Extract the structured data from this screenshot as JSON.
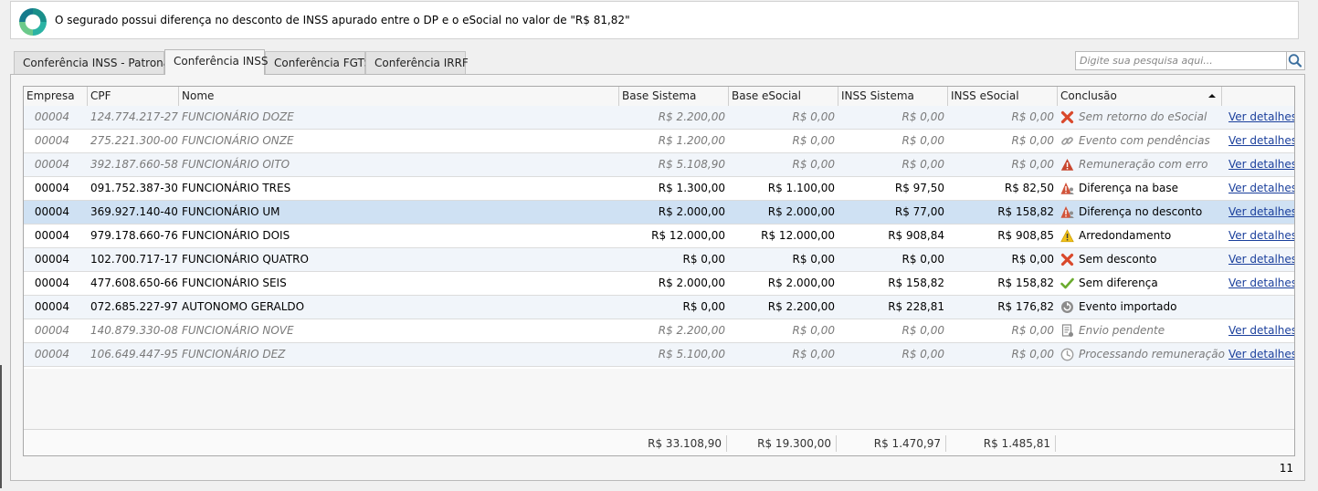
{
  "banner": {
    "message": "O segurado possui diferença no desconto de INSS apurado entre o DP e o eSocial no valor de \"R$ 81,82\""
  },
  "tabs": [
    {
      "label": "Conferência INSS - Patronal",
      "active": false
    },
    {
      "label": "Conferência INSS",
      "active": true
    },
    {
      "label": "Conferência FGTS",
      "active": false
    },
    {
      "label": "Conferência IRRF",
      "active": false
    }
  ],
  "search": {
    "placeholder": "Digite sua pesquisa aqui..."
  },
  "columns": [
    "Empresa",
    "CPF",
    "Nome",
    "Base Sistema",
    "Base eSocial",
    "INSS Sistema",
    "INSS eSocial",
    "Conclusão"
  ],
  "link_label": "Ver detalhes",
  "rows": [
    {
      "empresa": "00004",
      "cpf": "124.774.217-27",
      "nome": "FUNCIONÁRIO DOZE",
      "base_sistema": "R$ 2.200,00",
      "base_esocial": "R$ 0,00",
      "inss_sistema": "R$ 0,00",
      "inss_esocial": "R$ 0,00",
      "conclusao": "Sem retorno do eSocial",
      "icon": "red-x-icon",
      "link": true,
      "style": "dim"
    },
    {
      "empresa": "00004",
      "cpf": "275.221.300-00",
      "nome": "FUNCIONÁRIO ONZE",
      "base_sistema": "R$ 1.200,00",
      "base_esocial": "R$ 0,00",
      "inss_sistema": "R$ 0,00",
      "inss_esocial": "R$ 0,00",
      "conclusao": "Evento com pendências",
      "icon": "chain-link-icon",
      "link": true,
      "style": "dim"
    },
    {
      "empresa": "00004",
      "cpf": "392.187.660-58",
      "nome": "FUNCIONÁRIO OITO",
      "base_sistema": "R$ 5.108,90",
      "base_esocial": "R$ 0,00",
      "inss_sistema": "R$ 0,00",
      "inss_esocial": "R$ 0,00",
      "conclusao": "Remuneração com erro",
      "icon": "red-warning-icon",
      "link": true,
      "style": "dim"
    },
    {
      "empresa": "00004",
      "cpf": "091.752.387-30",
      "nome": "FUNCIONÁRIO TRES",
      "base_sistema": "R$ 1.300,00",
      "base_esocial": "R$ 1.100,00",
      "inss_sistema": "R$ 97,50",
      "inss_esocial": "R$ 82,50",
      "conclusao": "Diferença na base",
      "icon": "warning-person-icon",
      "link": true,
      "style": "normal"
    },
    {
      "empresa": "00004",
      "cpf": "369.927.140-40",
      "nome": "FUNCIONÁRIO UM",
      "base_sistema": "R$ 2.000,00",
      "base_esocial": "R$ 2.000,00",
      "inss_sistema": "R$ 77,00",
      "inss_esocial": "R$ 158,82",
      "conclusao": "Diferença no desconto",
      "icon": "warning-person-icon",
      "link": true,
      "style": "selected"
    },
    {
      "empresa": "00004",
      "cpf": "979.178.660-76",
      "nome": "FUNCIONÁRIO DOIS",
      "base_sistema": "R$ 12.000,00",
      "base_esocial": "R$ 12.000,00",
      "inss_sistema": "R$ 908,84",
      "inss_esocial": "R$ 908,85",
      "conclusao": "Arredondamento",
      "icon": "yellow-warning-icon",
      "link": true,
      "style": "normal"
    },
    {
      "empresa": "00004",
      "cpf": "102.700.717-17",
      "nome": "FUNCIONÁRIO QUATRO",
      "base_sistema": "R$ 0,00",
      "base_esocial": "R$ 0,00",
      "inss_sistema": "R$ 0,00",
      "inss_esocial": "R$ 0,00",
      "conclusao": "Sem desconto",
      "icon": "red-x-icon",
      "link": true,
      "style": "normal"
    },
    {
      "empresa": "00004",
      "cpf": "477.608.650-66",
      "nome": "FUNCIONÁRIO SEIS",
      "base_sistema": "R$ 2.000,00",
      "base_esocial": "R$ 2.000,00",
      "inss_sistema": "R$ 158,82",
      "inss_esocial": "R$ 158,82",
      "conclusao": "Sem diferença",
      "icon": "green-check-icon",
      "link": true,
      "style": "normal"
    },
    {
      "empresa": "00004",
      "cpf": "072.685.227-97",
      "nome": "AUTONOMO GERALDO",
      "base_sistema": "R$ 0,00",
      "base_esocial": "R$ 2.200,00",
      "inss_sistema": "R$ 228,81",
      "inss_esocial": "R$ 176,82",
      "conclusao": "Evento importado",
      "icon": "import-icon",
      "link": false,
      "style": "normal"
    },
    {
      "empresa": "00004",
      "cpf": "140.879.330-08",
      "nome": "FUNCIONÁRIO NOVE",
      "base_sistema": "R$ 2.200,00",
      "base_esocial": "R$ 0,00",
      "inss_sistema": "R$ 0,00",
      "inss_esocial": "R$ 0,00",
      "conclusao": "Envio pendente",
      "icon": "document-icon",
      "link": true,
      "style": "dim"
    },
    {
      "empresa": "00004",
      "cpf": "106.649.447-95",
      "nome": "FUNCIONÁRIO DEZ",
      "base_sistema": "R$ 5.100,00",
      "base_esocial": "R$ 0,00",
      "inss_sistema": "R$ 0,00",
      "inss_esocial": "R$ 0,00",
      "conclusao": "Processando remuneração",
      "icon": "clock-icon",
      "link": true,
      "style": "dim"
    }
  ],
  "totals": {
    "base_sistema": "R$ 33.108,90",
    "base_esocial": "R$ 19.300,00",
    "inss_sistema": "R$ 1.470,97",
    "inss_esocial": "R$ 1.485,81"
  },
  "record_count": "11"
}
